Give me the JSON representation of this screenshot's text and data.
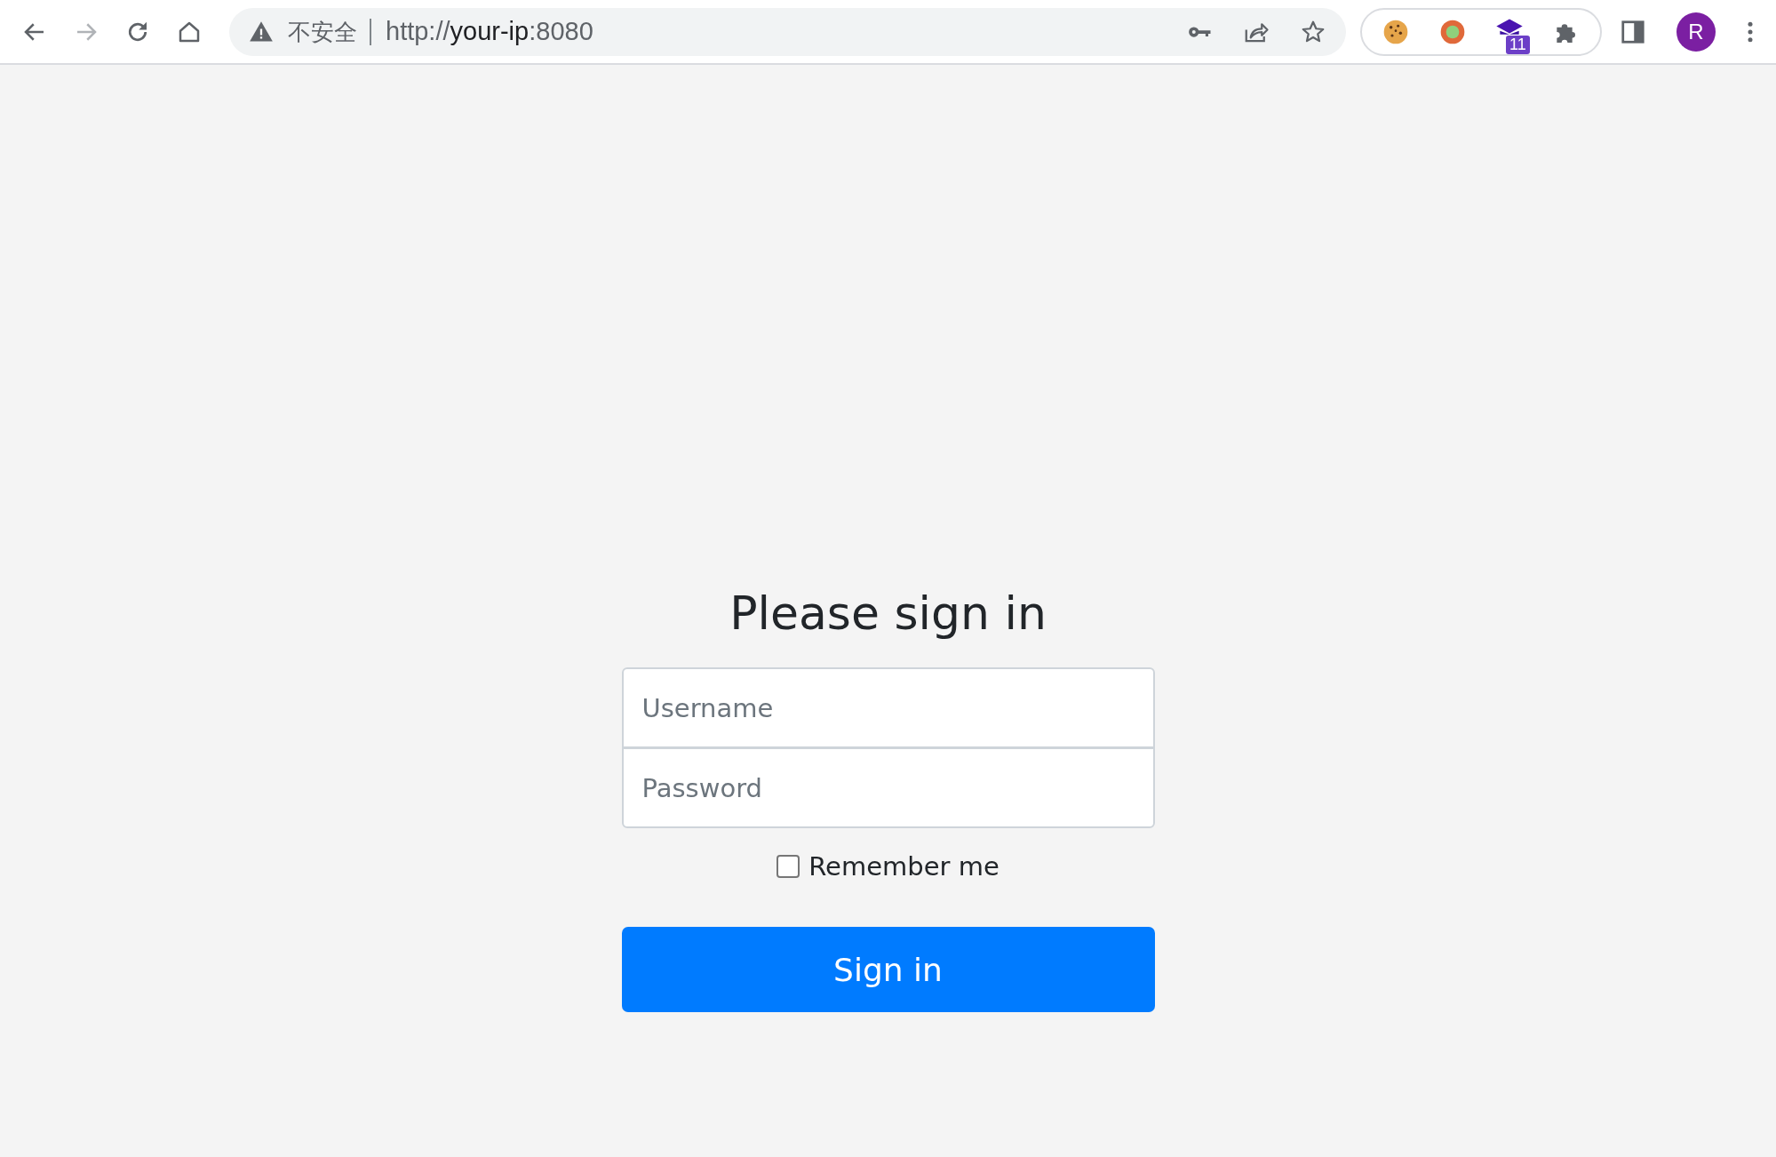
{
  "browser": {
    "nav": [
      {
        "kind": "back",
        "disabled": false
      },
      {
        "kind": "forward",
        "disabled": true
      },
      {
        "kind": "reload",
        "disabled": false
      },
      {
        "kind": "home",
        "disabled": false
      }
    ],
    "security_label": "不安全",
    "url": {
      "scheme": "http://",
      "host": "your-ip",
      "port": ":8080"
    },
    "extensions": [
      {
        "kind": "cookie"
      },
      {
        "kind": "ring"
      },
      {
        "kind": "cap",
        "badge": "11"
      },
      {
        "kind": "puzzle"
      }
    ],
    "profile": "R"
  },
  "form": {
    "title": "Please sign in",
    "fields": [
      {
        "placeholder": "Username"
      },
      {
        "placeholder": "Password"
      }
    ],
    "remember": {
      "label": "Remember me",
      "checked": false
    },
    "submit": "Sign in"
  }
}
